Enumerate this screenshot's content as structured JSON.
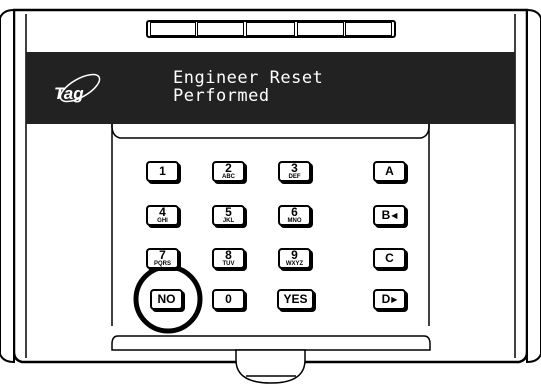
{
  "brand": {
    "logo_text": "Tag"
  },
  "display": {
    "line1": "Engineer Reset",
    "line2": "Performed"
  },
  "keypad": {
    "keys": [
      {
        "id": "1",
        "main": "1",
        "sub": ""
      },
      {
        "id": "2",
        "main": "2",
        "sub": "ABC"
      },
      {
        "id": "3",
        "main": "3",
        "sub": "DEF"
      },
      {
        "id": "A",
        "main": "A",
        "sub": ""
      },
      {
        "id": "4",
        "main": "4",
        "sub": "GHI"
      },
      {
        "id": "5",
        "main": "5",
        "sub": "JKL"
      },
      {
        "id": "6",
        "main": "6",
        "sub": "MNO"
      },
      {
        "id": "B",
        "main": "B",
        "sub": ""
      },
      {
        "id": "7",
        "main": "7",
        "sub": "PQRS"
      },
      {
        "id": "8",
        "main": "8",
        "sub": "TUV"
      },
      {
        "id": "9",
        "main": "9",
        "sub": "WXYZ"
      },
      {
        "id": "C",
        "main": "C",
        "sub": ""
      },
      {
        "id": "NO",
        "main": "NO",
        "sub": ""
      },
      {
        "id": "0",
        "main": "0",
        "sub": ""
      },
      {
        "id": "YES",
        "main": "YES",
        "sub": ""
      },
      {
        "id": "D",
        "main": "D",
        "sub": ""
      }
    ]
  },
  "highlight": {
    "target": "NO",
    "shape": "circle"
  },
  "icons": {
    "b_arrow": "left-arrow-icon",
    "d_arrow": "right-arrow-icon"
  },
  "colors": {
    "body": "#ffffff",
    "outline": "#000000",
    "display_bg": "#222222",
    "display_text": "#ffffff"
  }
}
